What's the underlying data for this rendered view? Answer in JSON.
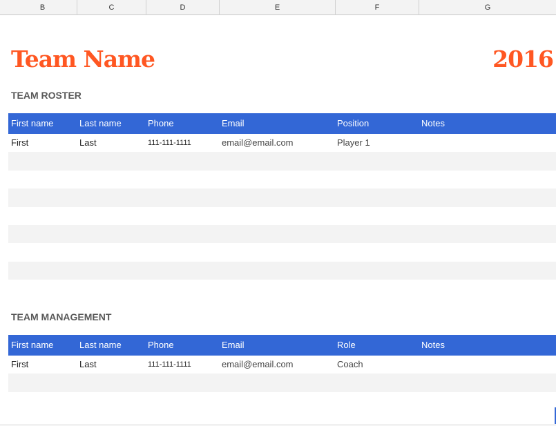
{
  "column_headers": [
    "B",
    "C",
    "D",
    "E",
    "F",
    "G"
  ],
  "sheet": {
    "title": "Team Name",
    "year": "2016",
    "accent_color": "#ff5722",
    "header_color": "#3367d6"
  },
  "roster": {
    "section_title": "TEAM ROSTER",
    "headers": [
      "First name",
      "Last name",
      "Phone",
      "Email",
      "Position",
      "Notes"
    ],
    "rows": [
      [
        "First",
        "Last",
        "111-111-1111",
        "email@email.com",
        "Player 1",
        ""
      ],
      [
        "",
        "",
        "",
        "",
        "",
        ""
      ],
      [
        "",
        "",
        "",
        "",
        "",
        ""
      ],
      [
        "",
        "",
        "",
        "",
        "",
        ""
      ],
      [
        "",
        "",
        "",
        "",
        "",
        ""
      ],
      [
        "",
        "",
        "",
        "",
        "",
        ""
      ],
      [
        "",
        "",
        "",
        "",
        "",
        ""
      ],
      [
        "",
        "",
        "",
        "",
        "",
        ""
      ]
    ]
  },
  "management": {
    "section_title": "TEAM MANAGEMENT",
    "headers": [
      "First name",
      "Last name",
      "Phone",
      "Email",
      "Role",
      "Notes"
    ],
    "rows": [
      [
        "First",
        "Last",
        "111-111-1111",
        "email@email.com",
        "Coach",
        ""
      ],
      [
        "",
        "",
        "",
        "",
        "",
        ""
      ]
    ]
  }
}
